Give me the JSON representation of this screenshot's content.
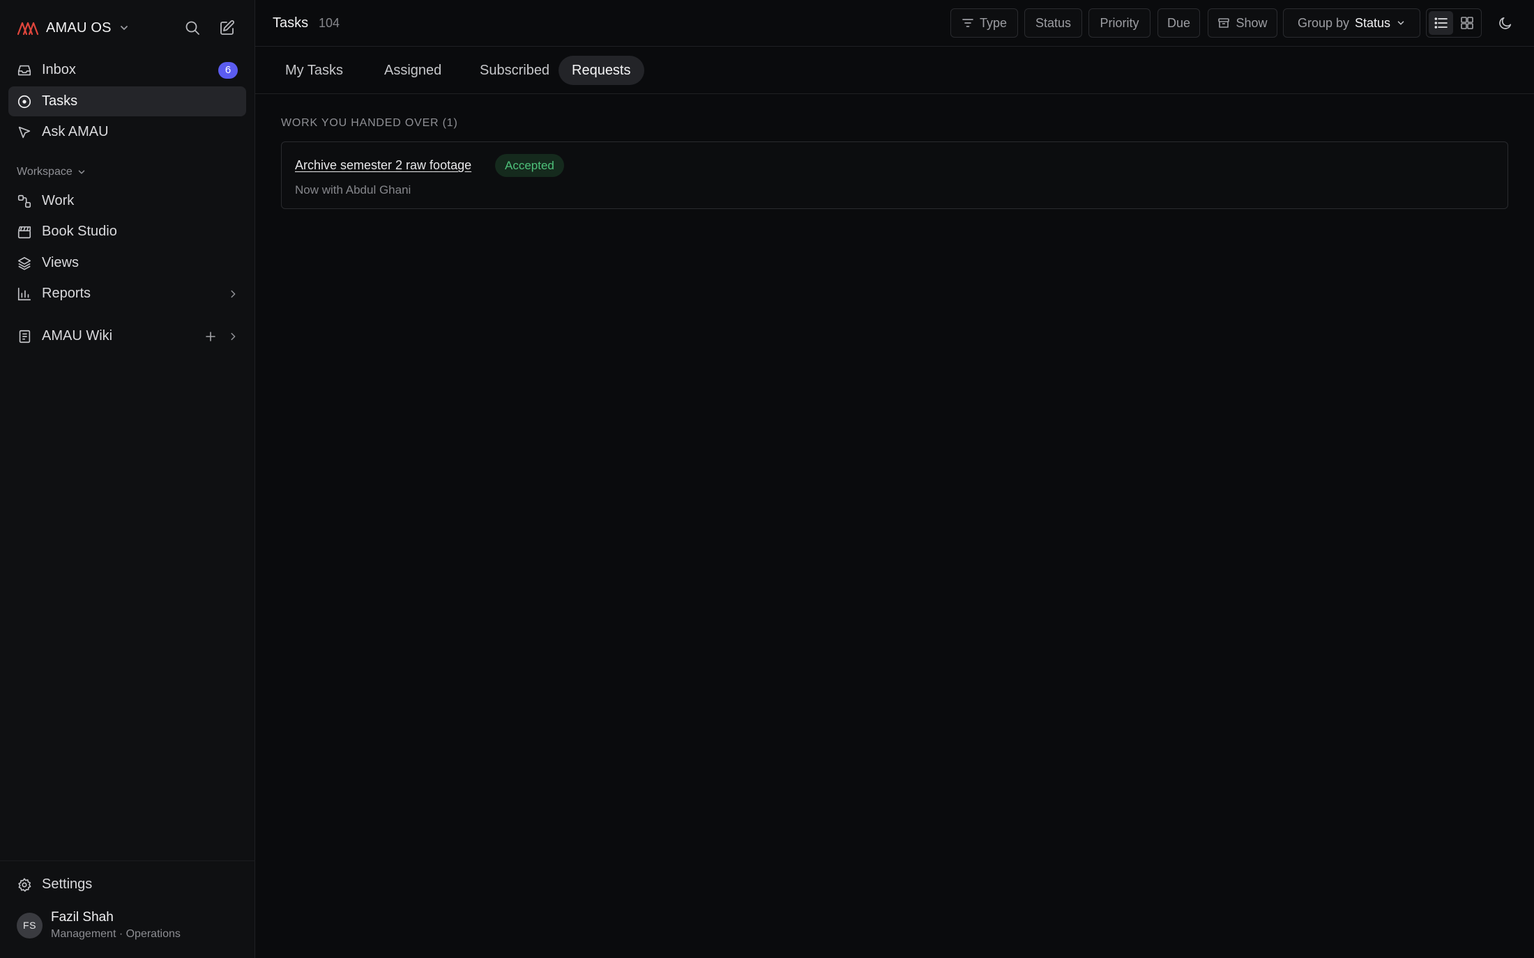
{
  "app": {
    "name": "AMAU OS",
    "logo_color": "#e0463c"
  },
  "sidebar": {
    "nav": [
      {
        "label": "Inbox",
        "icon": "inbox-icon",
        "badge": "6"
      },
      {
        "label": "Tasks",
        "icon": "tasks-icon",
        "active": true
      },
      {
        "label": "Ask AMAU",
        "icon": "cursor-icon"
      }
    ],
    "workspace_label": "Workspace",
    "workspace": [
      {
        "label": "Work",
        "icon": "workflow-icon"
      },
      {
        "label": "Book Studio",
        "icon": "clapperboard-icon"
      },
      {
        "label": "Views",
        "icon": "layers-icon"
      },
      {
        "label": "Reports",
        "icon": "bar-chart-icon"
      }
    ],
    "wiki": {
      "label": "AMAU Wiki",
      "icon": "book-icon"
    },
    "settings_label": "Settings",
    "user": {
      "initials": "FS",
      "name": "Fazil Shah",
      "role": "Management · Operations"
    }
  },
  "header": {
    "title": "Tasks",
    "count": "104",
    "filters": {
      "type": "Type",
      "status": "Status",
      "priority": "Priority",
      "due": "Due",
      "show": "Show",
      "group_by_label": "Group by",
      "group_by_value": "Status"
    }
  },
  "tabs": [
    {
      "label": "My Tasks"
    },
    {
      "label": "Assigned"
    },
    {
      "label": "Subscribed"
    },
    {
      "label": "Requests",
      "active": true
    }
  ],
  "main": {
    "group_heading": "WORK YOU HANDED OVER (1)",
    "items": [
      {
        "title": "Archive semester 2 raw footage",
        "status": "Accepted",
        "status_color": "#4ec17a",
        "subtitle": "Now with Abdul Ghani"
      }
    ]
  }
}
